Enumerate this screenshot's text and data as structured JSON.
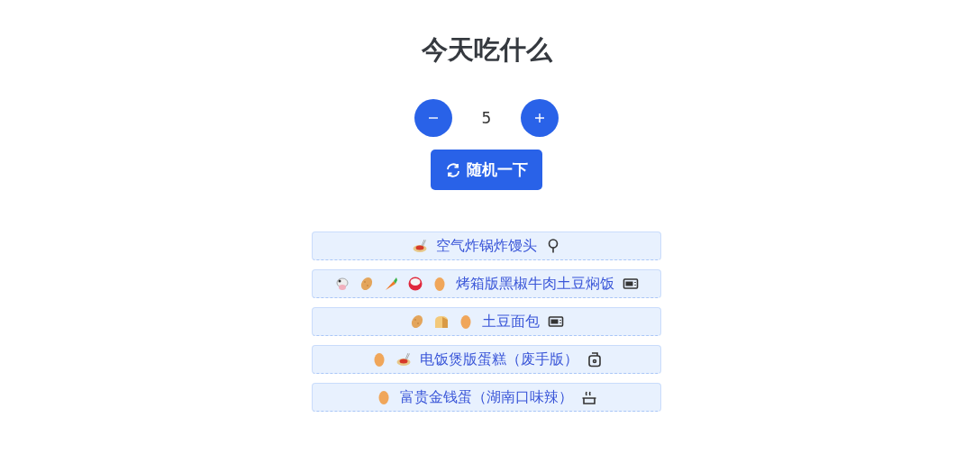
{
  "title": "今天吃什么",
  "counter": {
    "value": "5"
  },
  "random_button": {
    "label": "随机一下"
  },
  "dishes": [
    {
      "ingredients": [
        {
          "kind": "noodles"
        }
      ],
      "name": "空气炸锅炸馒头",
      "tool": {
        "kind": "fryer"
      }
    },
    {
      "ingredients": [
        {
          "kind": "cow"
        },
        {
          "kind": "potato"
        },
        {
          "kind": "carrot"
        },
        {
          "kind": "rice"
        },
        {
          "kind": "egg"
        }
      ],
      "name": "烤箱版黑椒牛肉土豆焖饭",
      "tool": {
        "kind": "oven"
      }
    },
    {
      "ingredients": [
        {
          "kind": "potato"
        },
        {
          "kind": "bread"
        },
        {
          "kind": "egg"
        }
      ],
      "name": "土豆面包",
      "tool": {
        "kind": "oven"
      }
    },
    {
      "ingredients": [
        {
          "kind": "egg"
        },
        {
          "kind": "noodles"
        }
      ],
      "name": "电饭煲版蛋糕（废手版）",
      "tool": {
        "kind": "cooker"
      }
    },
    {
      "ingredients": [
        {
          "kind": "egg"
        }
      ],
      "name": "富贵金钱蛋（湖南口味辣）",
      "tool": {
        "kind": "pot"
      }
    }
  ]
}
